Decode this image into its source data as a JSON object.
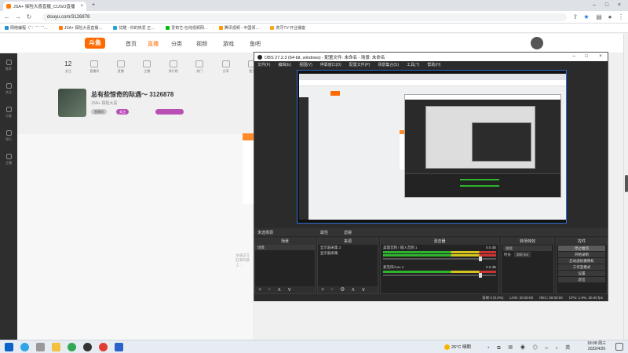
{
  "browser": {
    "tab_title": "JSA+ 探险大喜直播_CUGO直播",
    "url": "douyu.com/3126878",
    "bookmarks": [
      "网络编程（“ : ‘ “ ‘ ’ ”…",
      "JSA+ 探险大喜直播…",
      "优酷 - 你的热爱 正…",
      "爱奇艺-在线视频网…",
      "腾讯视频 - 中国领…",
      "虎牙TV-开业播客"
    ]
  },
  "site": {
    "logo": "斗鱼",
    "nav": [
      "首页",
      "直播",
      "分类",
      "视频",
      "游戏",
      "鱼吧"
    ],
    "sidebar": [
      "推荐",
      "关注",
      "分类",
      "排行",
      "主播"
    ],
    "subnav": [
      {
        "label": "关注",
        "value": "12"
      },
      {
        "label": "直播间"
      },
      {
        "label": "直播"
      },
      {
        "label": "主播"
      },
      {
        "label": "排行榜"
      },
      {
        "label": "热门"
      },
      {
        "label": "分享"
      },
      {
        "label": "更多"
      }
    ],
    "room_title": "总有些惊奇的际遇～ 3126878",
    "room_sub": "JSA+ 探险大喜",
    "room_tag": "直播间",
    "follow_label": "关注",
    "player_hint": "主播正在赶来的路上…"
  },
  "obs": {
    "title": "OBS 27.2.3 (64-bit, windows) - 配置文件: 未命名 - 场景: 未命名",
    "menu": [
      "文件(F)",
      "编辑(E)",
      "视图(V)",
      "停靠窗口(D)",
      "配置文件(P)",
      "场景集合(S)",
      "工具(T)",
      "帮助(H)"
    ],
    "infobar": {
      "no_source": "未选择源",
      "props": "属性",
      "filters": "滤镜"
    },
    "docks": {
      "scenes": {
        "header": "场景",
        "items": [
          "场景"
        ]
      },
      "sources": {
        "header": "来源",
        "items": [
          "显示器采集 2",
          "显示器采集"
        ]
      },
      "mixer": {
        "header": "混音器",
        "tracks": [
          {
            "name": "桌面音频 / 输入音频 1",
            "db": "0.0 dB"
          },
          {
            "name": "麦克风/Aux 1",
            "db": "0.0 dB"
          }
        ]
      },
      "transitions": {
        "header": "转场特效",
        "type": "淡化",
        "duration_label": "时长",
        "duration": "300 ms"
      },
      "controls": {
        "header": "控件",
        "buttons": [
          "停止推流",
          "开始录制",
          "启动虚拟摄像机",
          "工作室模式",
          "设置",
          "退出"
        ]
      }
    },
    "status": {
      "dropped": "丢帧 0 (0.0%)",
      "live": "LIVE: 00:00:00",
      "rec": "REC: 00:00:00",
      "cpu": "CPU: 1.9%, 30.00 fps"
    }
  },
  "taskbar": {
    "weather": "26°C 晴朗",
    "time": "18:08 周三",
    "date": "2022/4/20"
  }
}
